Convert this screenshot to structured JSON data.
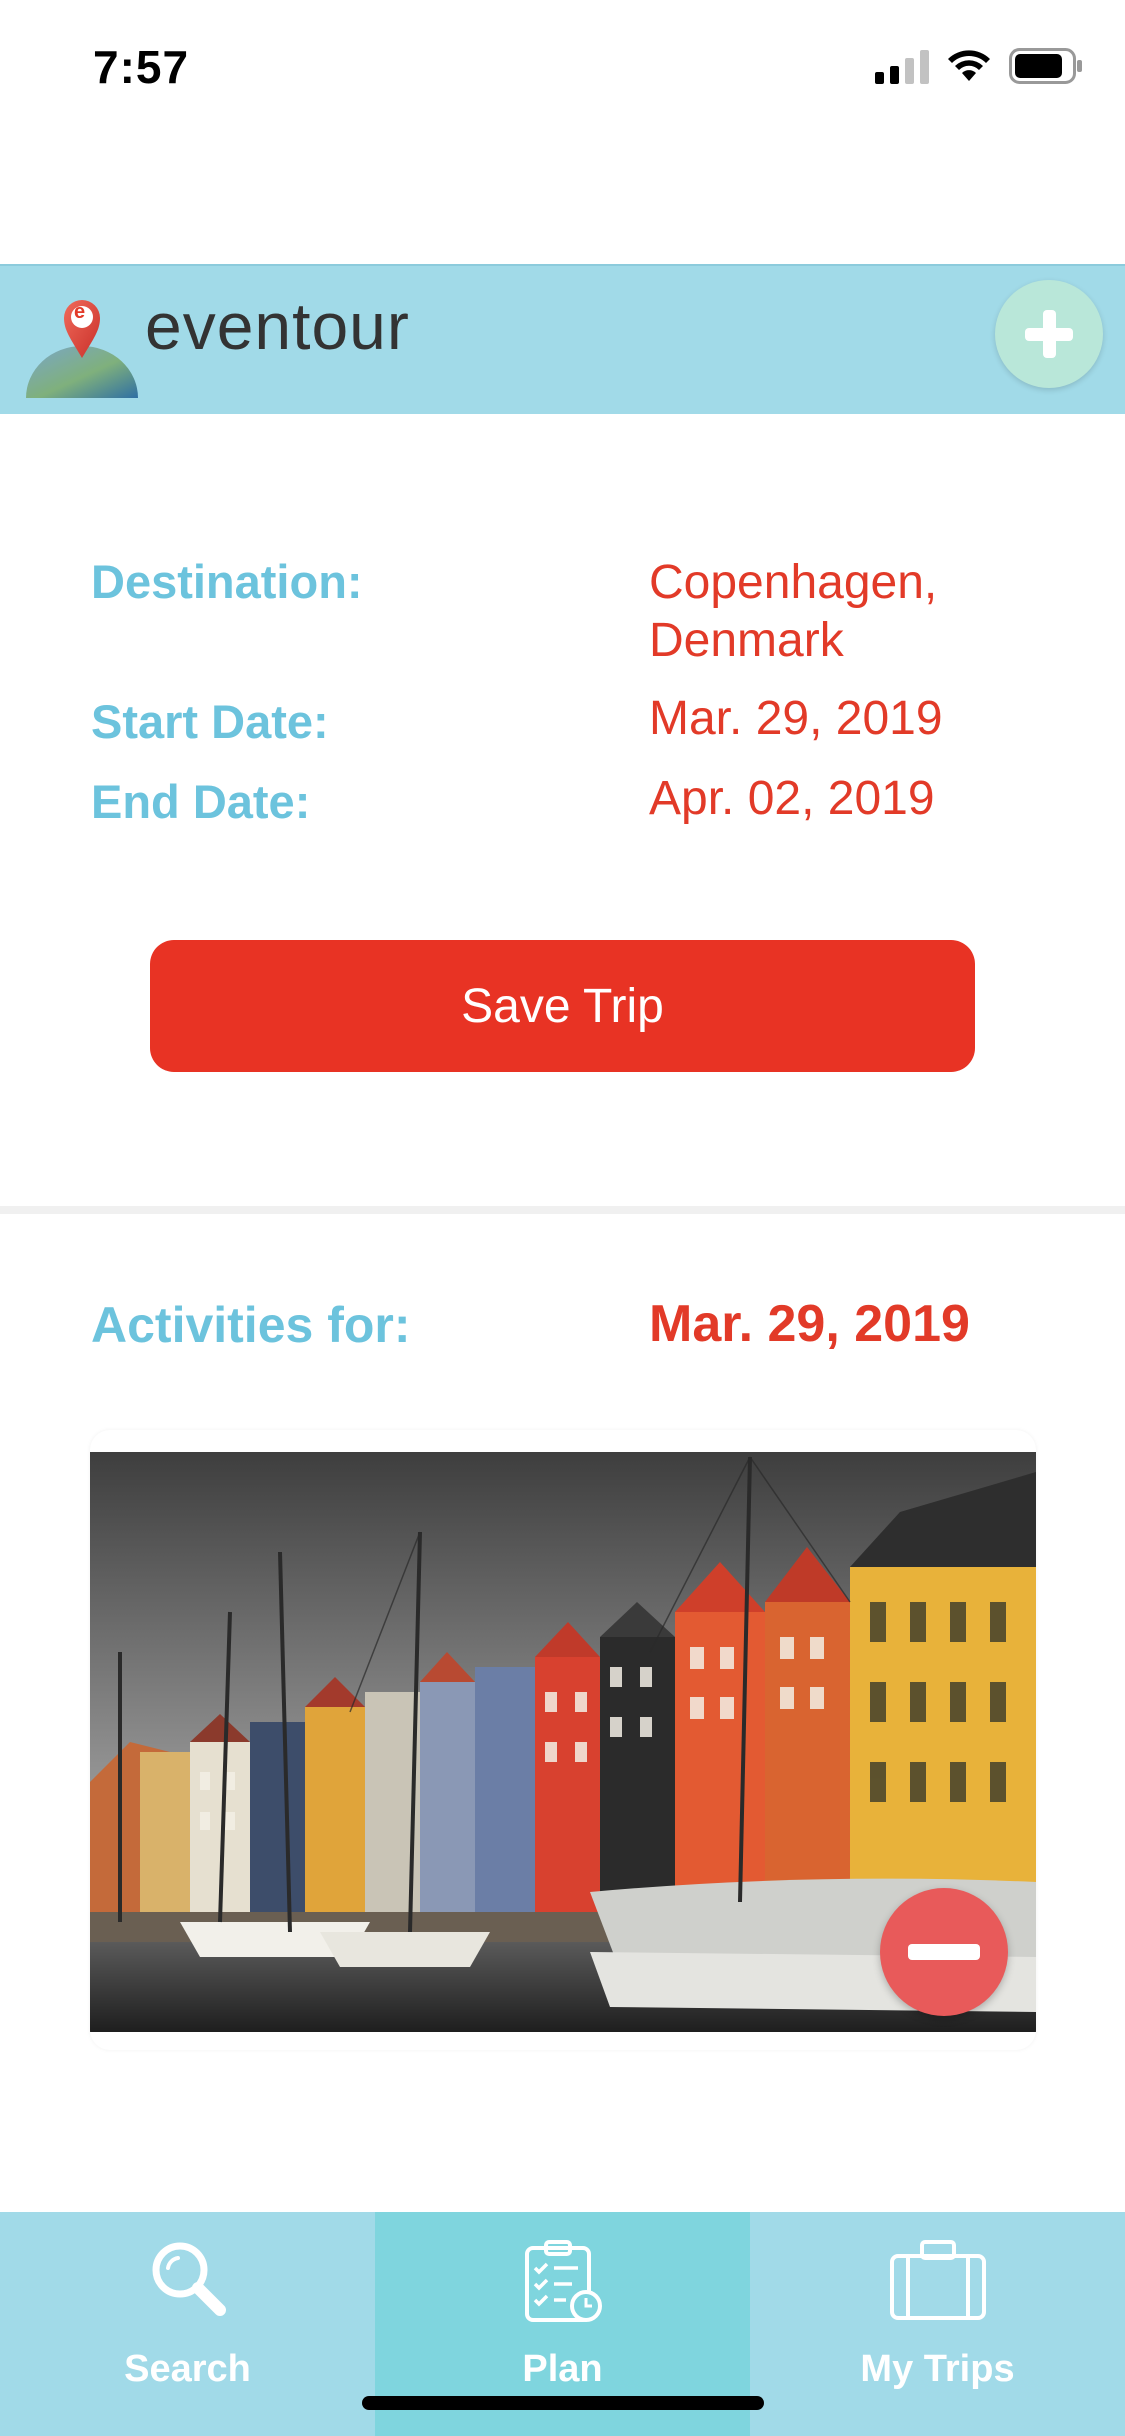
{
  "status_bar": {
    "time": "7:57"
  },
  "header": {
    "logo_text": "eventour",
    "logo_letter": "e",
    "add_icon": "plus-icon"
  },
  "trip": {
    "destination_label": "Destination:",
    "destination_line1": "Copenhagen,",
    "destination_line2": "Denmark",
    "start_label": "Start Date:",
    "start_value": "Mar. 29, 2019",
    "end_label": "End Date:",
    "end_value": "Apr. 02, 2019",
    "save_label": "Save Trip"
  },
  "activities": {
    "label": "Activities for:",
    "date": "Mar. 29, 2019",
    "photo_subject": "Nyhavn harbour, colourful buildings and sailing boats",
    "remove_icon": "minus-icon"
  },
  "tabs": [
    {
      "label": "Search",
      "icon": "search-icon",
      "active": false
    },
    {
      "label": "Plan",
      "icon": "checklist-icon",
      "active": true
    },
    {
      "label": "My Trips",
      "icon": "suitcase-icon",
      "active": false
    }
  ],
  "colors": {
    "accent_blue": "#a1dae8",
    "label_blue": "#6cc3dd",
    "value_red": "#e23a28",
    "button_red": "#e83324",
    "active_tab": "#7fd5de"
  }
}
